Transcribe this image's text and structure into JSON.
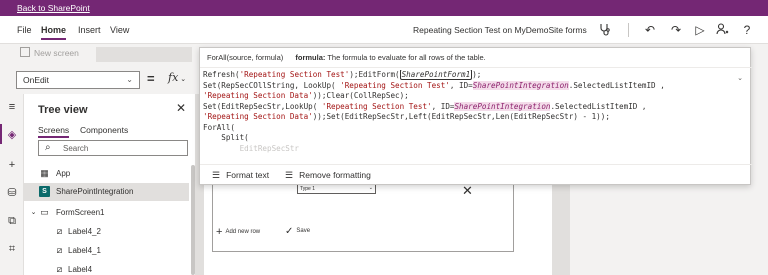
{
  "topbar": {
    "back_link": "Back to SharePoint"
  },
  "menubar": {
    "items": [
      "File",
      "Home",
      "Insert",
      "View"
    ],
    "active": "Home",
    "app_title": "Repeating Section Test on MyDemoSite forms"
  },
  "toolbar_icons": [
    "stethoscope-icon",
    "undo-icon",
    "redo-icon",
    "play-icon",
    "person-icon",
    "help-icon"
  ],
  "ribbon": {
    "new_screen_label": "New screen"
  },
  "formula_bar": {
    "property": "OnEdit",
    "equals": "=",
    "fx": "fx"
  },
  "formula_popup": {
    "signature": "ForAll(source, formula)",
    "param_name": "formula:",
    "param_desc": "The formula to evaluate for all rows of the table.",
    "lines": [
      "Refresh('Repeating Section Test');EditForm(SharePointForm1);",
      "Set(RepSecCOllString, LookUp( 'Repeating Section Test', ID=SharePointIntegration.SelectedListItemID ,",
      "'Repeating Section Data'));Clear(CollRepSec);",
      "Set(EditRepSecStr,LookUp( 'Repeating Section Test', ID=SharePointIntegration.SelectedListItemID ,",
      "'Repeating Section Data'));Set(EditRepSecStr,Left(EditRepSecStr,Len(EditRepSecStr) - 1));",
      "ForAll(",
      "    Split(",
      "        EditRepSecStr"
    ],
    "format_text": "Format text",
    "remove_formatting": "Remove formatting"
  },
  "tree_view": {
    "title": "Tree view",
    "tabs": [
      "Screens",
      "Components"
    ],
    "active_tab": "Screens",
    "search_placeholder": "Search",
    "items": [
      {
        "label": "App",
        "icon": "app-icon",
        "indent": 0
      },
      {
        "label": "SharePointIntegration",
        "icon": "sharepoint-icon",
        "indent": 0,
        "selected": true
      },
      {
        "label": "FormScreen1",
        "icon": "screen-icon",
        "indent": 0,
        "expandable": true
      },
      {
        "label": "Label4_2",
        "icon": "label-icon",
        "indent": 1
      },
      {
        "label": "Label4_1",
        "icon": "label-icon",
        "indent": 1
      },
      {
        "label": "Label4",
        "icon": "label-icon",
        "indent": 1
      }
    ]
  },
  "canvas": {
    "type_select_value": "Type 1",
    "add_new_row": "Add new row",
    "save": "Save"
  }
}
